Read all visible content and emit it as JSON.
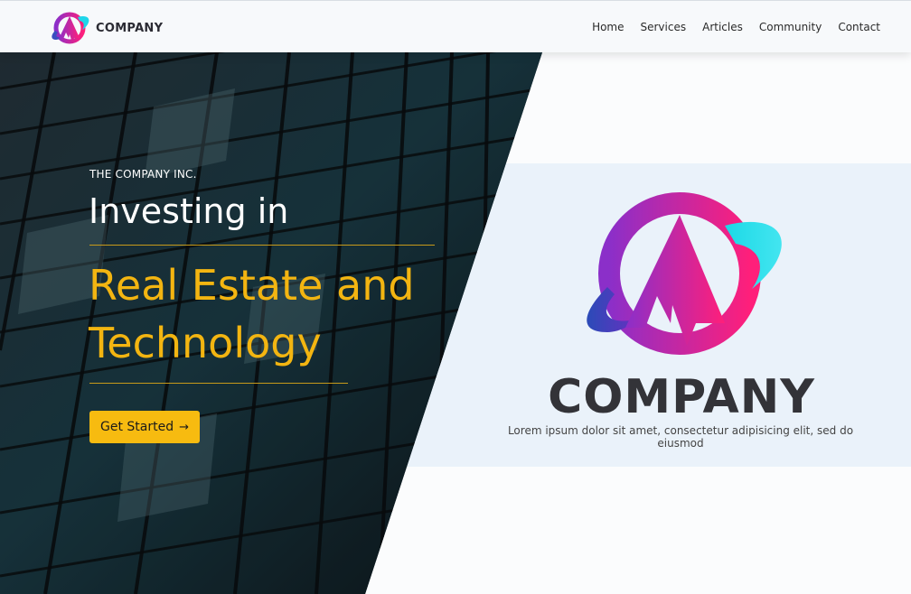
{
  "brand": {
    "name": "COMPANY",
    "logo_icon": "company-logo-icon"
  },
  "nav": {
    "items": [
      {
        "label": "Home"
      },
      {
        "label": "Services"
      },
      {
        "label": "Articles"
      },
      {
        "label": "Community"
      },
      {
        "label": "Contact"
      }
    ]
  },
  "hero": {
    "kicker": "THE COMPANY INC.",
    "headline_line1": "Investing in",
    "headline_line2": "Real Estate and Technology",
    "cta_label": "Get Started",
    "cta_icon": "arrow-right-icon",
    "background_image": "glass-skyscraper-photo"
  },
  "showcase": {
    "logo_text": "COMPANY",
    "tagline": "Lorem ipsum dolor sit amet, consectetur adipisicing elit, sed do eiusmod"
  },
  "colors": {
    "accent": "#f7bb10",
    "headline_accent": "#f3b511",
    "logo_gradient_start": "#8a2be2",
    "logo_gradient_end": "#ff1f7a",
    "logo_swoosh": "#1fd6ea",
    "panel_bg": "#eaf2fa",
    "nav_bg": "#f7f9fb"
  }
}
